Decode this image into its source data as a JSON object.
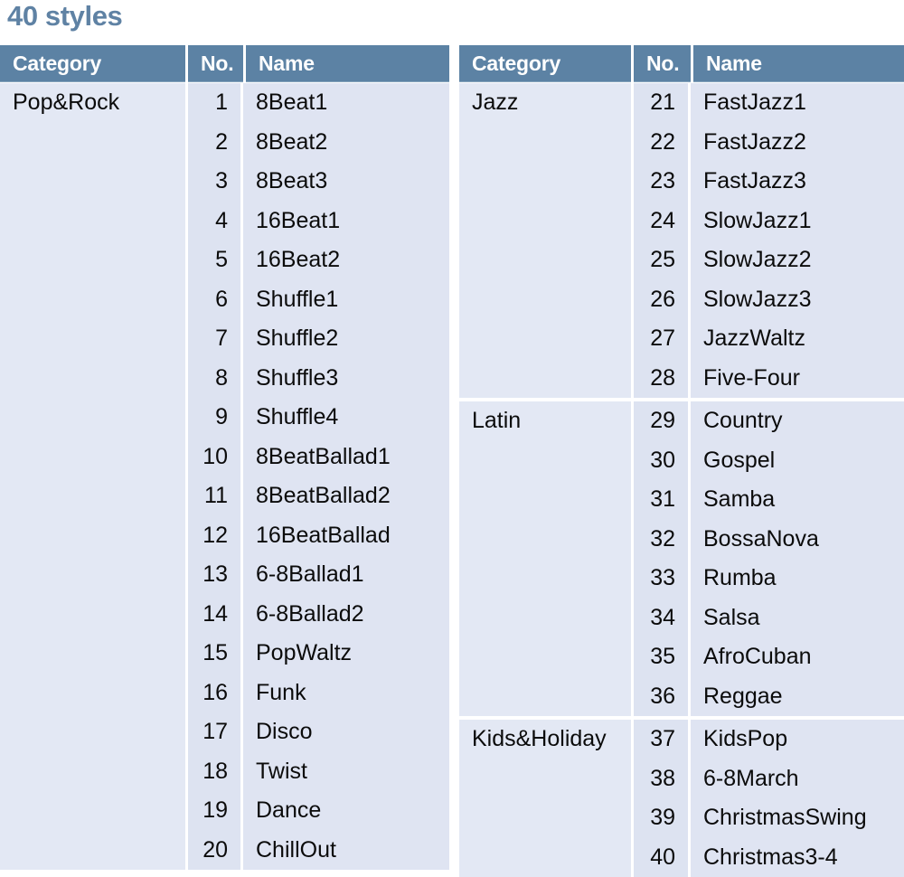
{
  "title": "40 styles",
  "colors": {
    "title_text": "#5f82a4",
    "header_bg": "#5c82a4",
    "header_text": "#ffffff",
    "category_cell_bg": "#e3e8f4",
    "row_bg": "#dde3f1",
    "page_bg": "#ffffff"
  },
  "tables": [
    {
      "id": "left",
      "headers": {
        "category": "Category",
        "no": "No.",
        "name": "Name"
      },
      "groups": [
        {
          "category": "Pop&Rock",
          "rows": [
            {
              "no": "1",
              "name": "8Beat1"
            },
            {
              "no": "2",
              "name": "8Beat2"
            },
            {
              "no": "3",
              "name": "8Beat3"
            },
            {
              "no": "4",
              "name": "16Beat1"
            },
            {
              "no": "5",
              "name": "16Beat2"
            },
            {
              "no": "6",
              "name": "Shuffle1"
            },
            {
              "no": "7",
              "name": "Shuffle2"
            },
            {
              "no": "8",
              "name": "Shuffle3"
            },
            {
              "no": "9",
              "name": "Shuffle4"
            },
            {
              "no": "10",
              "name": "8BeatBallad1"
            },
            {
              "no": "11",
              "name": "8BeatBallad2"
            },
            {
              "no": "12",
              "name": "16BeatBallad"
            },
            {
              "no": "13",
              "name": "6-8Ballad1"
            },
            {
              "no": "14",
              "name": "6-8Ballad2"
            },
            {
              "no": "15",
              "name": "PopWaltz"
            },
            {
              "no": "16",
              "name": "Funk"
            },
            {
              "no": "17",
              "name": "Disco"
            },
            {
              "no": "18",
              "name": "Twist"
            },
            {
              "no": "19",
              "name": "Dance"
            },
            {
              "no": "20",
              "name": "ChillOut"
            }
          ]
        }
      ]
    },
    {
      "id": "right",
      "headers": {
        "category": "Category",
        "no": "No.",
        "name": "Name"
      },
      "groups": [
        {
          "category": "Jazz",
          "rows": [
            {
              "no": "21",
              "name": "FastJazz1"
            },
            {
              "no": "22",
              "name": "FastJazz2"
            },
            {
              "no": "23",
              "name": "FastJazz3"
            },
            {
              "no": "24",
              "name": "SlowJazz1"
            },
            {
              "no": "25",
              "name": "SlowJazz2"
            },
            {
              "no": "26",
              "name": "SlowJazz3"
            },
            {
              "no": "27",
              "name": "JazzWaltz"
            },
            {
              "no": "28",
              "name": "Five-Four"
            }
          ]
        },
        {
          "category": "Latin",
          "rows": [
            {
              "no": "29",
              "name": "Country"
            },
            {
              "no": "30",
              "name": "Gospel"
            },
            {
              "no": "31",
              "name": "Samba"
            },
            {
              "no": "32",
              "name": "BossaNova"
            },
            {
              "no": "33",
              "name": "Rumba"
            },
            {
              "no": "34",
              "name": "Salsa"
            },
            {
              "no": "35",
              "name": "AfroCuban"
            },
            {
              "no": "36",
              "name": "Reggae"
            }
          ]
        },
        {
          "category": "Kids&Holiday",
          "rows": [
            {
              "no": "37",
              "name": "KidsPop"
            },
            {
              "no": "38",
              "name": "6-8March"
            },
            {
              "no": "39",
              "name": "ChristmasSwing"
            },
            {
              "no": "40",
              "name": "Christmas3-4"
            }
          ]
        }
      ]
    }
  ]
}
